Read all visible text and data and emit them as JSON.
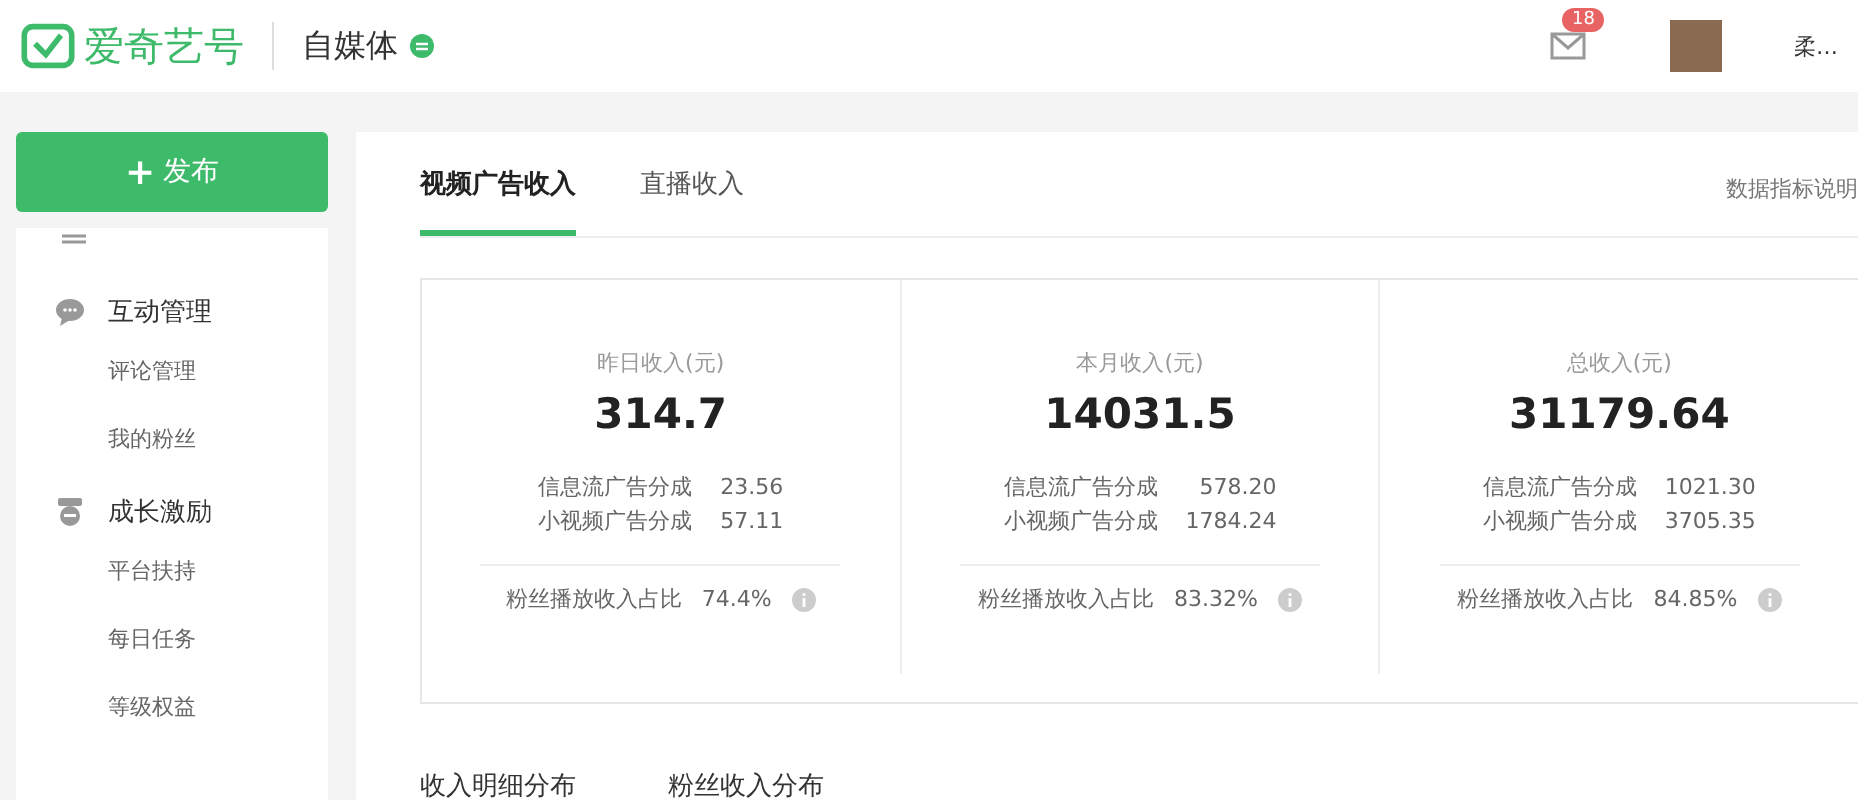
{
  "header": {
    "logo_text": "爱奇艺号",
    "section": "自媒体",
    "mail_badge": "18",
    "user_name": "柔…"
  },
  "publish_button": {
    "label": "发布",
    "icon": "+"
  },
  "sidebar": {
    "groups": [
      {
        "title": "互动管理",
        "kind": "chat",
        "items": [
          {
            "label": "评论管理",
            "selected": false
          },
          {
            "label": "我的粉丝",
            "selected": false
          }
        ]
      },
      {
        "title": "成长激励",
        "kind": "medal",
        "items": [
          {
            "label": "平台扶持",
            "selected": false
          },
          {
            "label": "每日任务",
            "selected": false
          },
          {
            "label": "等级权益",
            "selected": false
          }
        ]
      }
    ]
  },
  "tabs": [
    {
      "label": "视频广告收入",
      "selected": true
    },
    {
      "label": "直播收入",
      "selected": false
    }
  ],
  "help_link": "数据指标说明",
  "stats": [
    {
      "title": "昨日收入(元)",
      "value": "314.7",
      "rows": [
        {
          "label": "信息流广告分成",
          "value": "23.56"
        },
        {
          "label": "小视频广告分成",
          "value": "57.11"
        }
      ],
      "ratio_label": "粉丝播放收入占比",
      "ratio": "74.4%"
    },
    {
      "title": "本月收入(元)",
      "value": "14031.5",
      "rows": [
        {
          "label": "信息流广告分成",
          "value": "578.20"
        },
        {
          "label": "小视频广告分成",
          "value": "1784.24"
        }
      ],
      "ratio_label": "粉丝播放收入占比",
      "ratio": "83.32%"
    },
    {
      "title": "总收入(元)",
      "value": "31179.64",
      "rows": [
        {
          "label": "信息流广告分成",
          "value": "1021.30"
        },
        {
          "label": "小视频广告分成",
          "value": "3705.35"
        }
      ],
      "ratio_label": "粉丝播放收入占比",
      "ratio": "84.85%"
    }
  ],
  "sub_tabs": [
    {
      "label": "收入明细分布"
    },
    {
      "label": "粉丝收入分布"
    }
  ]
}
